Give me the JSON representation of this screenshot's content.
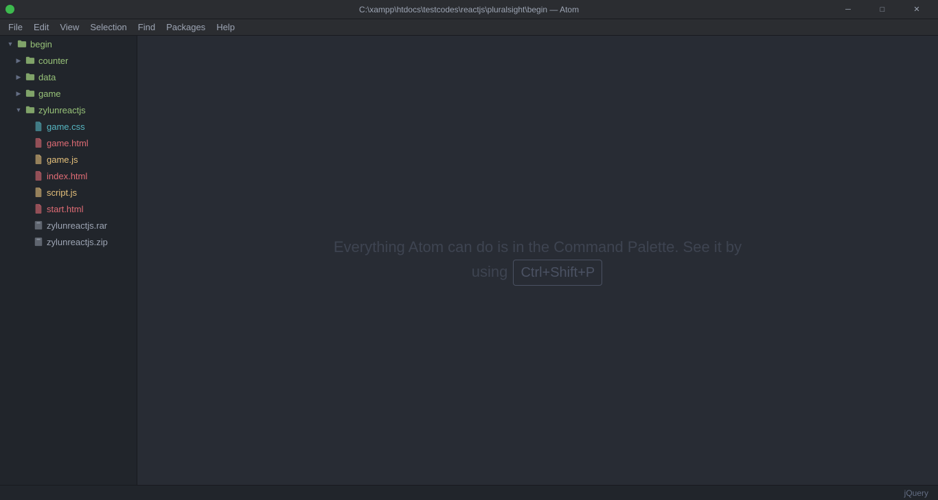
{
  "titleBar": {
    "title": "C:\\xampp\\htdocs\\testcodes\\reactjs\\pluralsight\\begin — Atom",
    "trafficLights": [
      "green",
      "yellow",
      "red"
    ]
  },
  "windowControls": {
    "minimize": "─",
    "maximize": "□",
    "close": "✕"
  },
  "menuBar": {
    "items": [
      "File",
      "Edit",
      "View",
      "Selection",
      "Find",
      "Packages",
      "Help"
    ]
  },
  "sidebar": {
    "rootLabel": "begin",
    "items": [
      {
        "type": "folder",
        "label": "counter",
        "indent": 1,
        "open": false
      },
      {
        "type": "folder",
        "label": "data",
        "indent": 1,
        "open": false
      },
      {
        "type": "folder",
        "label": "game",
        "indent": 1,
        "open": false
      },
      {
        "type": "folder",
        "label": "zylunreactjs",
        "indent": 1,
        "open": true
      },
      {
        "type": "file",
        "label": "game.css",
        "indent": 2,
        "ext": "css"
      },
      {
        "type": "file",
        "label": "game.html",
        "indent": 2,
        "ext": "html"
      },
      {
        "type": "file",
        "label": "game.js",
        "indent": 2,
        "ext": "js"
      },
      {
        "type": "file",
        "label": "index.html",
        "indent": 2,
        "ext": "html"
      },
      {
        "type": "file",
        "label": "script.js",
        "indent": 2,
        "ext": "js"
      },
      {
        "type": "file",
        "label": "start.html",
        "indent": 2,
        "ext": "html"
      },
      {
        "type": "file",
        "label": "zylunreactjs.rar",
        "indent": 2,
        "ext": "rar"
      },
      {
        "type": "file",
        "label": "zylunreactjs.zip",
        "indent": 2,
        "ext": "zip"
      }
    ]
  },
  "editor": {
    "welcomeLine1": "Everything Atom can do is in the Command Palette. See it by",
    "welcomeLine2": "using ",
    "welcomeShortcut": "Ctrl+Shift+P"
  },
  "statusBar": {
    "rightItem": "jQuery"
  }
}
